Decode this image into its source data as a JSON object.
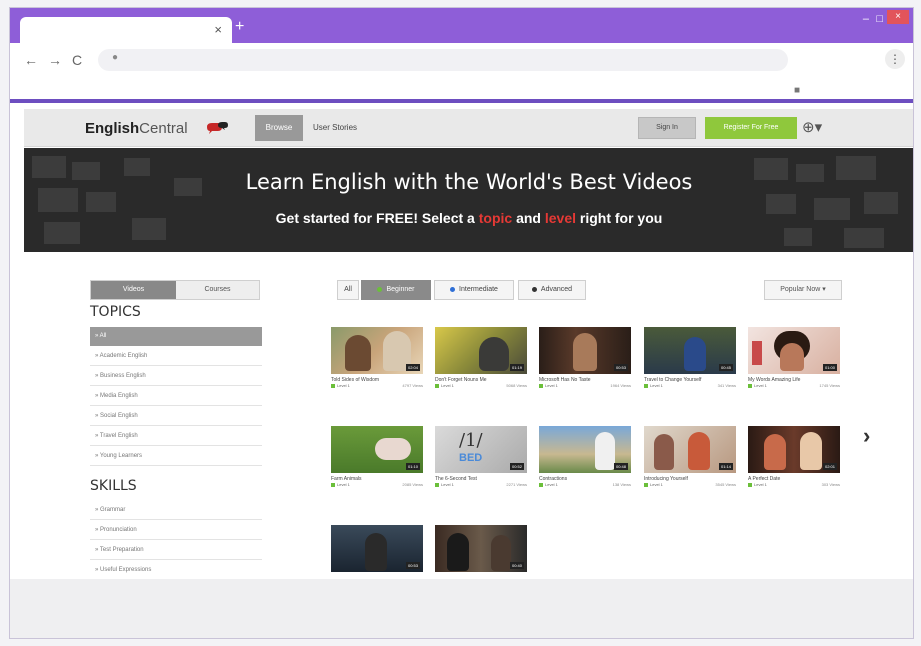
{
  "browser": {
    "new_tab": "+",
    "tab_close": "×",
    "min": "–",
    "max": "□",
    "close": "×",
    "back": "←",
    "forward": "→",
    "reload": "C",
    "menu": "⋮"
  },
  "header": {
    "logo_bold": "English",
    "logo_rest": "Central",
    "nav_active": "Browse",
    "nav_link": "User Stories",
    "signin": "Sign In",
    "register": "Register For Free"
  },
  "hero": {
    "title": "Learn English with the World's Best Videos",
    "sub_1": "Get started for FREE! Select a ",
    "sub_topic": "topic",
    "sub_2": " and ",
    "sub_level": "level",
    "sub_3": " right for you"
  },
  "sidebar": {
    "toggle_videos": "Videos",
    "toggle_courses": "Courses",
    "topics_heading": "TOPICS",
    "topics": [
      "» All",
      "» Academic English",
      "» Business English",
      "» Media English",
      "» Social English",
      "» Travel English",
      "» Young Learners"
    ],
    "skills_heading": "SKILLS",
    "skills": [
      "» Grammar",
      "» Pronunciation",
      "» Test Preparation",
      "» Useful Expressions"
    ]
  },
  "filters": {
    "all": "All",
    "beginner": "Beginner",
    "intermediate": "Intermediate",
    "advanced": "Advanced",
    "popular": "Popular Now ▾"
  },
  "colors": {
    "beginner": "#6bbf3a",
    "intermediate": "#2f6fd6",
    "advanced": "#333333",
    "accent": "#8e5ed8",
    "register": "#8fc83c"
  },
  "videos": [
    {
      "title": "Told Sides of Wisdom",
      "level": "Level 1",
      "views": "4797 Views",
      "dur": "02:04"
    },
    {
      "title": "Don't Forget Nouns Me",
      "level": "Level 1",
      "views": "5068 Views",
      "dur": "01:19"
    },
    {
      "title": "Microsoft Has No Taste",
      "level": "Level 1",
      "views": "1964 Views",
      "dur": "00:53"
    },
    {
      "title": "Travel to Change Yourself",
      "level": "Level 1",
      "views": "341 Views",
      "dur": "00:45"
    },
    {
      "title": "My Words Amazing Life",
      "level": "Level 1",
      "views": "1745 Views",
      "dur": "01:00"
    },
    {
      "title": "Farm Animals",
      "level": "Level 1",
      "views": "2085 Views",
      "dur": "01:10"
    },
    {
      "title": "The 6-Second Test",
      "level": "Level 1",
      "views": "2271 Views",
      "dur": "00:52"
    },
    {
      "title": "Contractions",
      "level": "Level 1",
      "views": "138 Views",
      "dur": "00:48"
    },
    {
      "title": "Introducing Yourself",
      "level": "Level 1",
      "views": "3545 Views",
      "dur": "01:14"
    },
    {
      "title": "A Perfect Date",
      "level": "Level 1",
      "views": "303 Views",
      "dur": "02:01"
    },
    {
      "title": "",
      "level": "",
      "views": "",
      "dur": "00:53"
    },
    {
      "title": "",
      "level": "",
      "views": "",
      "dur": "00:40"
    }
  ],
  "next_arrow": "›"
}
